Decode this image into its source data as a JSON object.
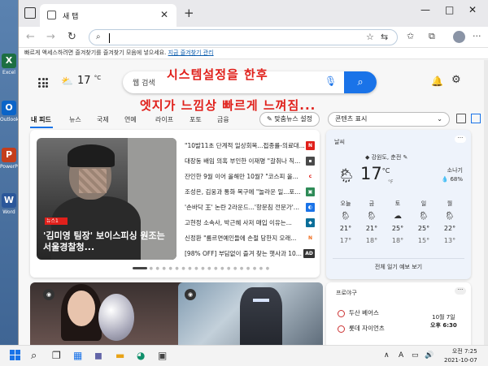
{
  "desktop": {
    "icons": [
      {
        "label": "Excel",
        "letter": "X",
        "color": "#1d6f42"
      },
      {
        "label": "Outlook",
        "letter": "O",
        "color": "#0a64c8"
      },
      {
        "label": "PowerPoint",
        "letter": "P",
        "color": "#c43e1c"
      },
      {
        "label": "Word",
        "letter": "W",
        "color": "#2b579a"
      }
    ]
  },
  "browser": {
    "tab_title": "새 탭",
    "address_value": "",
    "favbar_text": "빠르게 액세스하려면 즐겨찾기를 즐겨찾기 모음에 넣으세요.",
    "favbar_link": "지금 즐겨찾기 관리",
    "window_controls": [
      "—",
      "□",
      "✕"
    ]
  },
  "newtab": {
    "weather_temp": "17",
    "weather_unit": "°C",
    "search_placeholder": "웹 검색",
    "overlay_line1": "시스템설정을 한후",
    "overlay_line2": "엣지가 느낌상 빠르게 느껴짐...",
    "categories": [
      "내 피드",
      "뉴스",
      "국제",
      "연예",
      "라이프",
      "포토",
      "금융"
    ],
    "personalize_label": "맞춤뉴스 설정",
    "content_display_label": "콘텐츠 표시"
  },
  "feature_story": {
    "badge": "뉴스1",
    "caption": "'김미영 팀장' 보이스피싱 원조는 서울경찰청..."
  },
  "headlines": [
    {
      "text": "\"10발11초 단계적 일상회복...접종률-의료대...",
      "src": "N",
      "color": "#e0201b"
    },
    {
      "text": "대장동 배임 의혹 부인한 이재명 \"갈취나 직...",
      "src": "▪",
      "color": "#4a4a4a"
    },
    {
      "text": "잔인한 9월 이어 올해만 10월? \"코스피 올...",
      "src": "c",
      "color": "#e0201b"
    },
    {
      "text": "조성은, 김웅과 통화 복구에 \"놀라운 일...포...",
      "src": "▣",
      "color": "#2e8b57"
    },
    {
      "text": "'손바닥 王' 논란 2라운드...'항문침 전문가'...",
      "src": "◐",
      "color": "#1a73e8"
    },
    {
      "text": "고현정 소속사, 박근혜 사저 매입 이유는...",
      "src": "◆",
      "color": "#0b6e99"
    },
    {
      "text": "신정환 \"룸르면예인들에 손절 당한지 오래...",
      "src": "N",
      "color": "#ef6b1a"
    },
    {
      "text": "[98% OFF] 부담없이 즐겨 찾는 햇사과 10...",
      "src": "AD",
      "color": "#333333"
    }
  ],
  "weather_card": {
    "title": "날씨",
    "location": "◆ 강원도, 춘전",
    "temp": "17",
    "unit": "°C",
    "unit_f": "°F",
    "condition": "소나기",
    "humidity": "💧 68%",
    "forecast": [
      {
        "day": "오늘",
        "hi": "21°",
        "lo": "17°"
      },
      {
        "day": "금",
        "hi": "21°",
        "lo": "18°"
      },
      {
        "day": "토",
        "hi": "25°",
        "lo": "18°"
      },
      {
        "day": "일",
        "hi": "25°",
        "lo": "15°"
      },
      {
        "day": "월",
        "hi": "22°",
        "lo": "13°"
      }
    ],
    "more_label": "전체 일기 예보 보기"
  },
  "sports": {
    "title": "프로야구",
    "team1": "두산 베어스",
    "team2": "롯데 자이언츠",
    "date": "10월 7일",
    "time": "오후 6:30"
  },
  "taskbar": {
    "lang": "A",
    "time": "오전 7:25",
    "date": "2021-10-07"
  }
}
